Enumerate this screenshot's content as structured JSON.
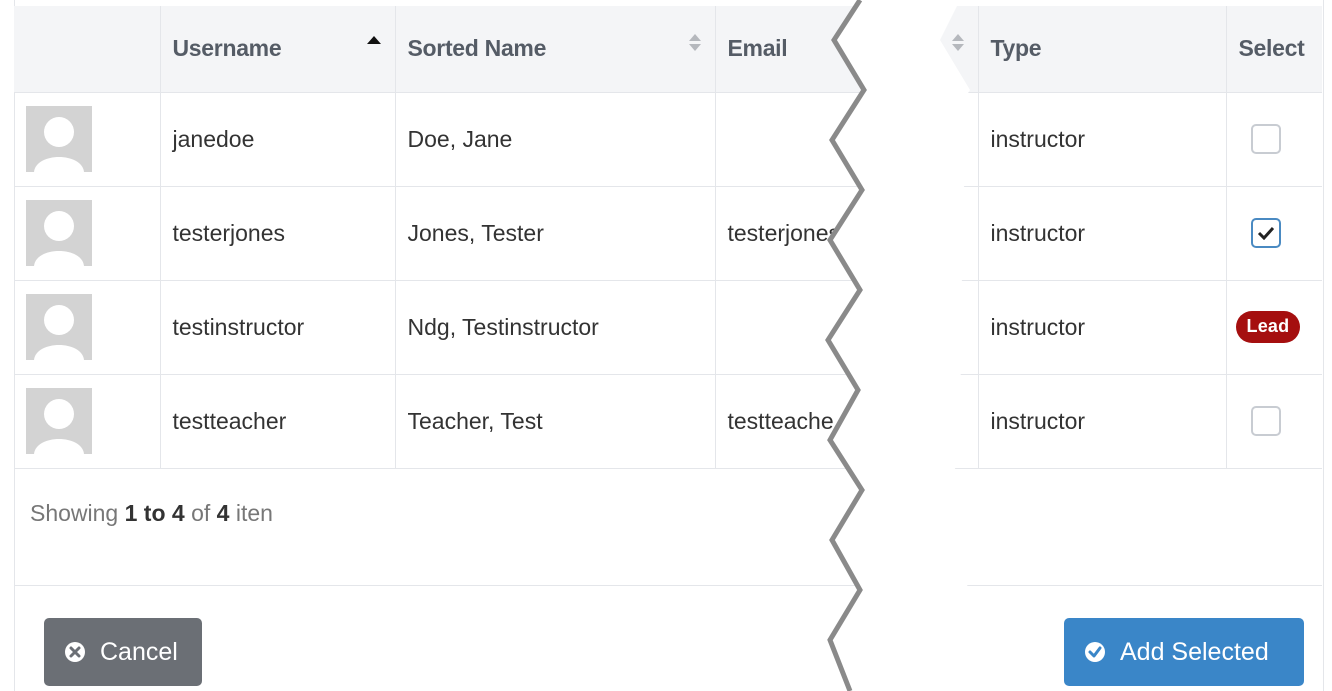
{
  "table": {
    "columns": [
      {
        "label": "",
        "sort": "none"
      },
      {
        "label": "Username",
        "sort": "asc"
      },
      {
        "label": "Sorted Name",
        "sort": "both"
      },
      {
        "label": "Email",
        "sort": "both"
      },
      {
        "label": "Type",
        "sort": "none"
      },
      {
        "label": "Select",
        "sort": "none"
      }
    ],
    "rows": [
      {
        "avatar": "user-avatar-placeholder",
        "username": "janedoe",
        "sorted_name": "Doe, Jane",
        "email": "",
        "type": "instructor",
        "select": "unchecked"
      },
      {
        "avatar": "user-avatar-placeholder",
        "username": "testerjones",
        "sorted_name": "Jones, Tester",
        "email": "testerjones;",
        "type": "instructor",
        "select": "checked"
      },
      {
        "avatar": "user-avatar-placeholder",
        "username": "testinstructor",
        "sorted_name": "Ndg, Testinstructor",
        "email": "",
        "type": "instructor",
        "select": "lead",
        "badge": "Lead"
      },
      {
        "avatar": "user-avatar-placeholder",
        "username": "testteacher",
        "sorted_name": "Teacher, Test",
        "email": "testteache",
        "type": "instructor",
        "select": "unchecked"
      }
    ]
  },
  "pagination": {
    "prefix": "Showing",
    "range": "1 to 4",
    "of": "of",
    "total": "4",
    "suffix": "iten"
  },
  "buttons": {
    "cancel": {
      "label": "Cancel",
      "icon": "times-circle-icon"
    },
    "add_selected": {
      "label": "Add Selected",
      "icon": "check-circle-icon"
    }
  },
  "colors": {
    "header_bg": "#f4f5f7",
    "border": "#e4e6ea",
    "lead_badge": "#a50f0f",
    "cancel_button": "#6b6f75",
    "add_button": "#3a86c8",
    "checkbox_checked": "#4a8ac2"
  }
}
